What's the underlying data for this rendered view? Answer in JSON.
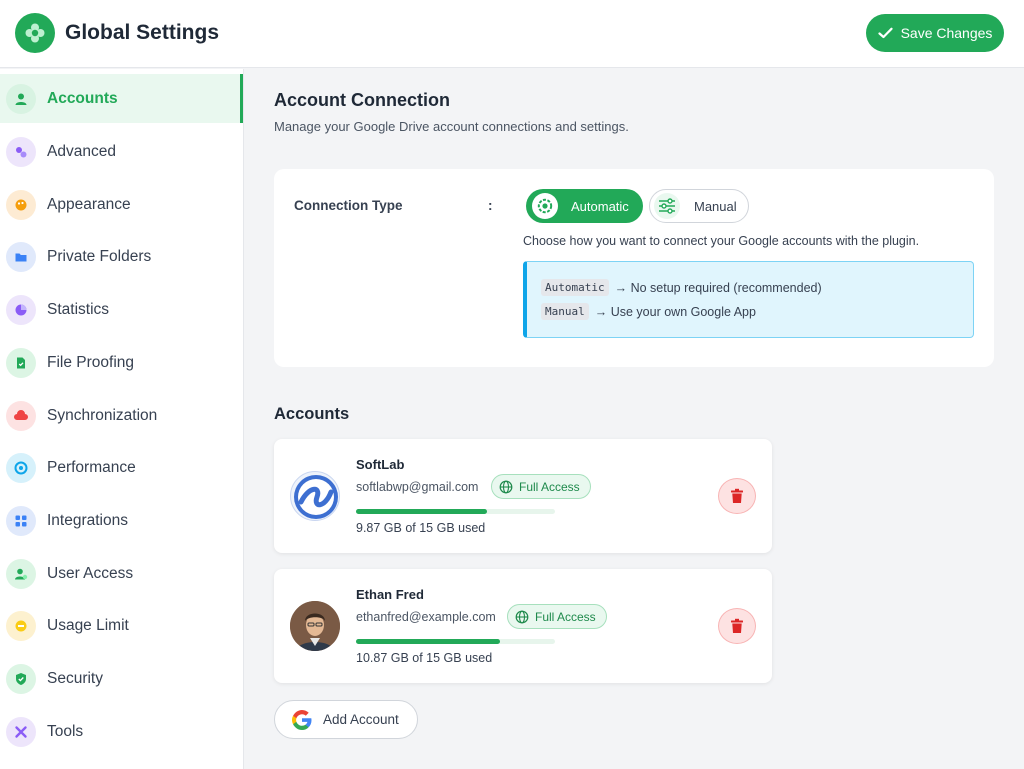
{
  "header": {
    "title": "Global Settings",
    "save_label": "Save Changes",
    "brand_color": "#22a958"
  },
  "sidebar": {
    "items": [
      {
        "label": "Accounts",
        "icon": "user-icon",
        "active": true,
        "icon_bg": "#d8f3e2",
        "icon_color": "#22a958"
      },
      {
        "label": "Advanced",
        "icon": "sliders-icon",
        "active": false,
        "icon_bg": "#ede5fb",
        "icon_color": "#8b5cf6"
      },
      {
        "label": "Appearance",
        "icon": "palette-icon",
        "active": false,
        "icon_bg": "#fdebd3",
        "icon_color": "#f59e0b"
      },
      {
        "label": "Private Folders",
        "icon": "folder-icon",
        "active": false,
        "icon_bg": "#e0e9fb",
        "icon_color": "#3b82f6"
      },
      {
        "label": "Statistics",
        "icon": "pie-chart-icon",
        "active": false,
        "icon_bg": "#ede5fb",
        "icon_color": "#8b5cf6"
      },
      {
        "label": "File Proofing",
        "icon": "file-check-icon",
        "active": false,
        "icon_bg": "#dcf5e4",
        "icon_color": "#22a958"
      },
      {
        "label": "Synchronization",
        "icon": "cloud-sync-icon",
        "active": false,
        "icon_bg": "#fde2e2",
        "icon_color": "#ef4444"
      },
      {
        "label": "Performance",
        "icon": "gauge-icon",
        "active": false,
        "icon_bg": "#d6f1fb",
        "icon_color": "#0ea5e9"
      },
      {
        "label": "Integrations",
        "icon": "grid-icon",
        "active": false,
        "icon_bg": "#e0e9fb",
        "icon_color": "#3b82f6"
      },
      {
        "label": "User Access",
        "icon": "user-check-icon",
        "active": false,
        "icon_bg": "#dcf5e4",
        "icon_color": "#22a958"
      },
      {
        "label": "Usage Limit",
        "icon": "limit-icon",
        "active": false,
        "icon_bg": "#fdf1cf",
        "icon_color": "#eab308"
      },
      {
        "label": "Security",
        "icon": "shield-icon",
        "active": false,
        "icon_bg": "#dcf5e4",
        "icon_color": "#22a958"
      },
      {
        "label": "Tools",
        "icon": "tools-icon",
        "active": false,
        "icon_bg": "#ede5fb",
        "icon_color": "#8b5cf6"
      }
    ]
  },
  "main": {
    "title": "Account Connection",
    "subtitle": "Manage your Google Drive account connections and settings.",
    "connection": {
      "label": "Connection Type",
      "separator": ":",
      "options": [
        {
          "label": "Automatic",
          "selected": true
        },
        {
          "label": "Manual",
          "selected": false
        }
      ],
      "help": "Choose how you want to connect your Google accounts with the plugin.",
      "info": [
        {
          "code": "Automatic",
          "text": "→ No setup required (recommended)"
        },
        {
          "code": "Manual",
          "text": "→ Use your own Google App"
        }
      ]
    },
    "accounts_title": "Accounts",
    "accounts": [
      {
        "name": "SoftLab",
        "email": "softlabwp@gmail.com",
        "access": "Full Access",
        "usage_text": "9.87 GB of 15 GB used",
        "usage_fraction": 0.658
      },
      {
        "name": "Ethan Fred",
        "email": "ethanfred@example.com",
        "access": "Full Access",
        "usage_text": "10.87 GB of 15 GB used",
        "usage_fraction": 0.725
      }
    ],
    "add_account_label": "Add Account"
  }
}
